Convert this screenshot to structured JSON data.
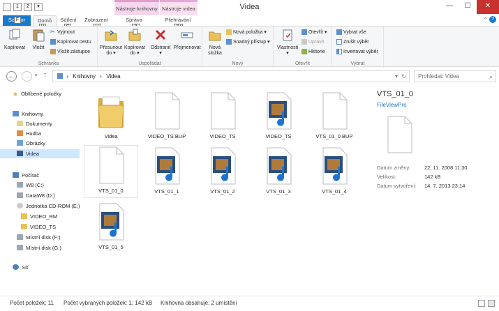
{
  "window": {
    "title": "Videa",
    "context_tab_library": "Nástroje knihovny",
    "context_tab_video": "Nástroje videa",
    "minimize": "—",
    "maximize": "☐",
    "close": "✕"
  },
  "quick_access": {
    "keytip_1": "1",
    "keytip_2": "2"
  },
  "tabs": [
    {
      "label": "Soubor",
      "keytip": "F"
    },
    {
      "label": "Domů",
      "keytip": "H"
    },
    {
      "label": "Sdílení",
      "keytip": "S"
    },
    {
      "label": "Zobrazení",
      "keytip": "V"
    },
    {
      "label": "Správa",
      "keytip": "JL"
    },
    {
      "label": "Přehrávání",
      "keytip": "JV"
    }
  ],
  "ribbon": {
    "schranka": {
      "label": "Schránka",
      "kopirovat": "Kopírovat",
      "vlozit": "Vložit",
      "vyjmout": "Vyjmout",
      "kopirovat_cestu": "Kopírovat cestu",
      "vlozit_zastupce": "Vložit zástupce"
    },
    "usporadat": {
      "label": "Uspořádat",
      "presunout": "Přesunout",
      "kopirovat": "Kopírovat",
      "do": "do ▾",
      "odstranit": "Odstranit",
      "prejmenovat": "Přejmenovat"
    },
    "novy": {
      "label": "Nový",
      "nova_slozka": "Nová",
      "nova_slozka_2": "složka",
      "nova_polozka": "Nová položka ▾",
      "snadny_pristup": "Snadný přístup ▾"
    },
    "otevrit": {
      "label": "Otevřít",
      "vlastnosti": "Vlastnosti",
      "otevrit": "Otevřít ▾",
      "upravit": "Upravit",
      "historie": "Historie"
    },
    "vybrat": {
      "label": "Vybrat",
      "vybrat_vse": "Vybrat vše",
      "zrusit_vyber": "Zrušit výběr",
      "invertovat": "Invertovat výběr"
    },
    "collapse": "⌃",
    "help": "?"
  },
  "address": {
    "back": "←",
    "forward": "→",
    "up": "↑",
    "path": [
      "Knihovny",
      "Videa"
    ],
    "sep": "›",
    "dropdown": "▾",
    "refresh": "↻",
    "search_placeholder": "Prohledat: Videa",
    "search_icon": "⌕"
  },
  "nav": [
    {
      "label": "Oblíbené položky",
      "icon": "star-icon"
    },
    {
      "label": "Knihovny",
      "icon": "libraries-icon"
    },
    {
      "label": "Dokumenty",
      "icon": "documents-icon"
    },
    {
      "label": "Hudba",
      "icon": "music-icon"
    },
    {
      "label": "Obrázky",
      "icon": "pictures-icon"
    },
    {
      "label": "Videa",
      "icon": "videos-icon",
      "selected": true
    },
    {
      "label": "Počítač",
      "icon": "computer-icon"
    },
    {
      "label": "W8 (C:)",
      "icon": "drive-icon"
    },
    {
      "label": "DataW8 (D:)",
      "icon": "drive-icon"
    },
    {
      "label": "Jednotka CD-ROM (E:)",
      "icon": "cdrom-icon"
    },
    {
      "label": "VIDEO_RM",
      "icon": "folder-icon"
    },
    {
      "label": "VIDEO_TS",
      "icon": "folder-icon"
    },
    {
      "label": "Místní disk (F:)",
      "icon": "drive-icon"
    },
    {
      "label": "Místní disk (G:)",
      "icon": "drive-icon"
    },
    {
      "label": "Síť",
      "icon": "network-icon"
    }
  ],
  "files": [
    {
      "name": "Videa",
      "type": "folder"
    },
    {
      "name": "VIDEO_TS.BUP",
      "type": "doc"
    },
    {
      "name": "VIDEO_TS",
      "type": "doc"
    },
    {
      "name": "VIDEO_TS",
      "type": "media"
    },
    {
      "name": "VTS_01_0.BUP",
      "type": "doc"
    },
    {
      "name": "VTS_01_0",
      "type": "doc",
      "selected": true
    },
    {
      "name": "VTS_01_1",
      "type": "media"
    },
    {
      "name": "VTS_01_2",
      "type": "media"
    },
    {
      "name": "VTS_01_3",
      "type": "media"
    },
    {
      "name": "VTS_01_4",
      "type": "media"
    },
    {
      "name": "VTS_01_5",
      "type": "media"
    }
  ],
  "details": {
    "title": "VTS_01_0",
    "app": "FileViewPro",
    "props": [
      {
        "label": "Datum změny:",
        "value": "22. 11. 2008 11:30"
      },
      {
        "label": "Velikost:",
        "value": "142 kB"
      },
      {
        "label": "Datum vytvoření:",
        "value": "14. 7. 2013 23:14"
      }
    ]
  },
  "status": {
    "count": "Počet položek: 11",
    "selected": "Počet vybraných položek: 1; 142 kB",
    "library": "Knihovna obsahuje: 2 umístění"
  },
  "colors": {
    "accent": "#1979ca",
    "selection": "#cde8ff",
    "close": "#c7322f"
  }
}
